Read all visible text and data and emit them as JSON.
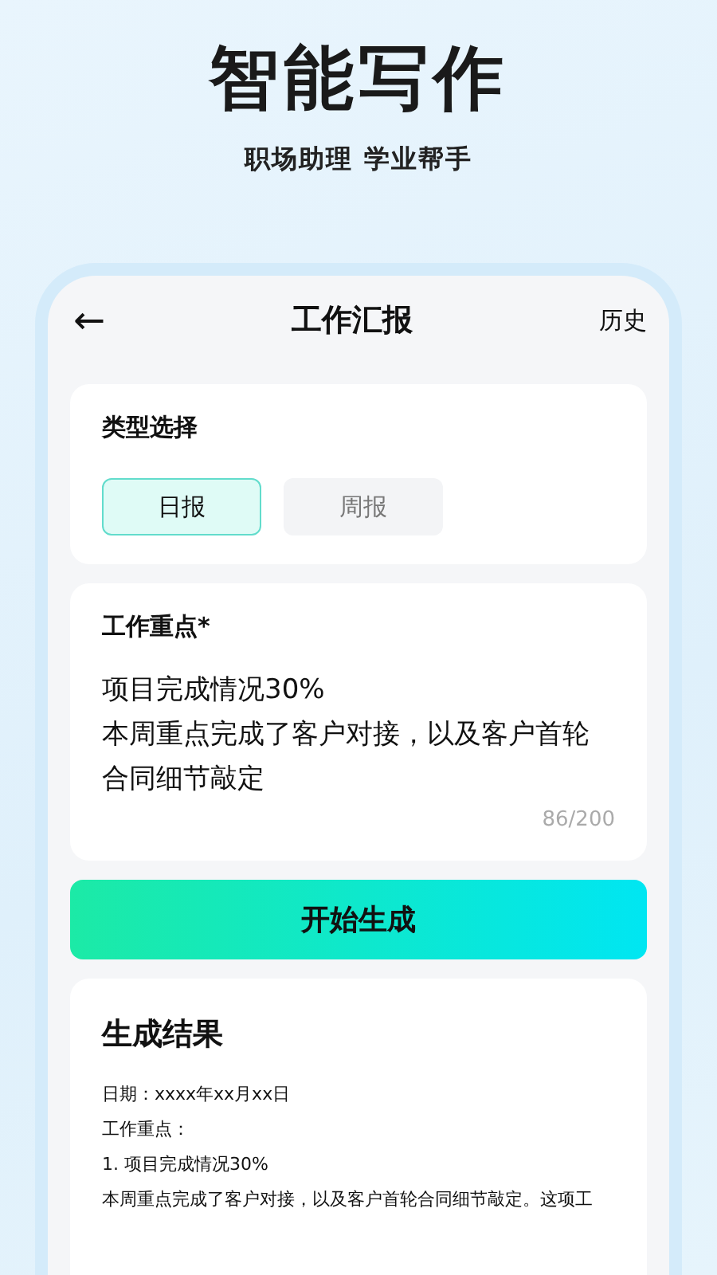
{
  "hero": {
    "title": "智能写作",
    "subtitle": "职场助理 学业帮手"
  },
  "header": {
    "back": "←",
    "title": "工作汇报",
    "action": "历史"
  },
  "type_select": {
    "label": "类型选择",
    "options": [
      {
        "label": "日报",
        "selected": true
      },
      {
        "label": "周报",
        "selected": false
      }
    ]
  },
  "focus": {
    "label": "工作重点*",
    "value": "项目完成情况30%\n本周重点完成了客户对接，以及客户首轮合同细节敲定",
    "counter": "86/200"
  },
  "generate_button": "开始生成",
  "result": {
    "title": "生成结果",
    "lines": [
      "日期：xxxx年xx月xx日",
      "工作重点：",
      "1. 项目完成情况30%",
      "本周重点完成了客户对接，以及客户首轮合同细节敲定。这项工"
    ]
  }
}
